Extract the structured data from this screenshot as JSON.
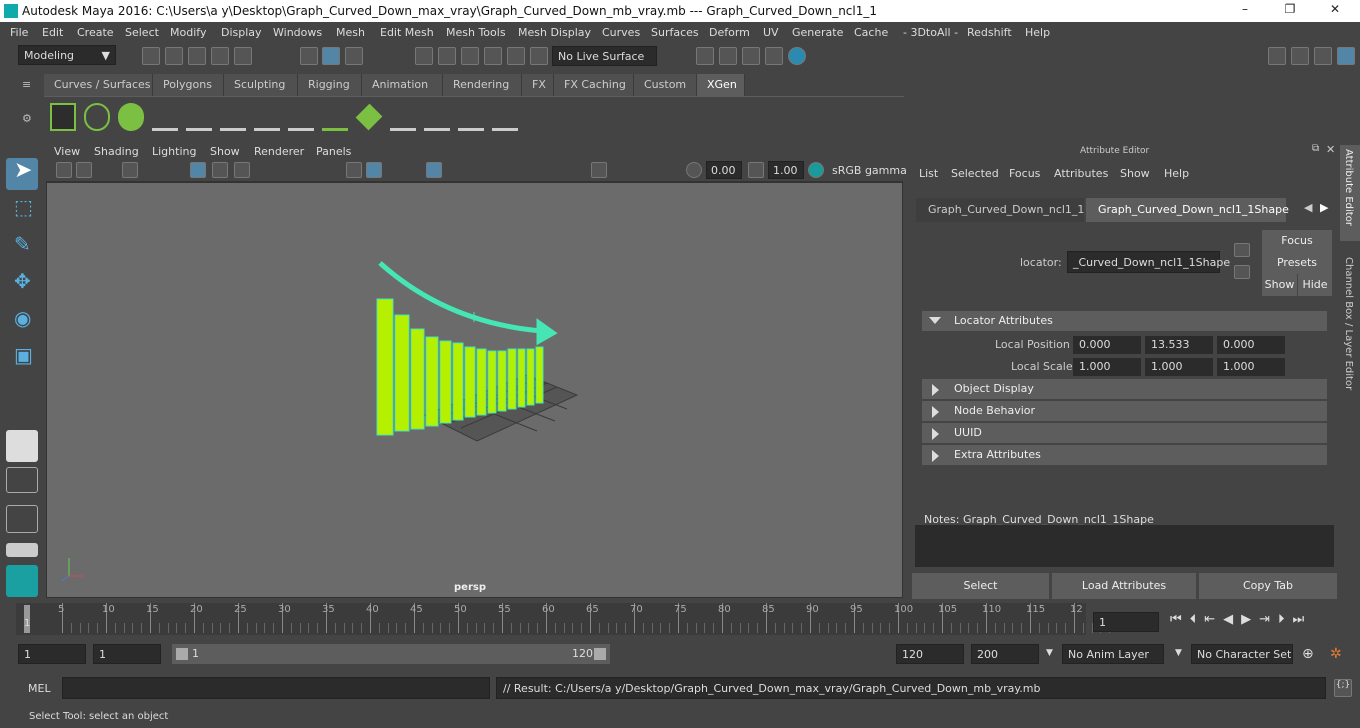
{
  "window": {
    "title": "Autodesk Maya 2016: C:\\Users\\a y\\Desktop\\Graph_Curved_Down_max_vray\\Graph_Curved_Down_mb_vray.mb   ---   Graph_Curved_Down_ncl1_1",
    "minimize": "–",
    "maximize": "❐",
    "close": "✕"
  },
  "menus": [
    "File",
    "Edit",
    "Create",
    "Select",
    "Modify",
    "Display",
    "Windows",
    "Mesh",
    "Edit Mesh",
    "Mesh Tools",
    "Mesh Display",
    "Curves",
    "Surfaces",
    "Deform",
    "UV",
    "Generate",
    "Cache",
    "- 3DtoAll -",
    "Redshift",
    "Help"
  ],
  "status": {
    "mode": "Modeling",
    "live_surface": "No Live Surface"
  },
  "shelf_tabs": [
    "Curves / Surfaces",
    "Polygons",
    "Sculpting",
    "Rigging",
    "Animation",
    "Rendering",
    "FX",
    "FX Caching",
    "Custom",
    "XGen"
  ],
  "shelf_active": "XGen",
  "viewport": {
    "menus": [
      "View",
      "Shading",
      "Lighting",
      "Show",
      "Renderer",
      "Panels"
    ],
    "exposure": "0.00",
    "gamma": "1.00",
    "colorspace": "sRGB gamma",
    "camera": "persp"
  },
  "ae": {
    "title": "Attribute Editor",
    "menus": [
      "List",
      "Selected",
      "Focus",
      "Attributes",
      "Show",
      "Help"
    ],
    "tabs": [
      "Graph_Curved_Down_ncl1_1",
      "Graph_Curved_Down_ncl1_1Shape"
    ],
    "locator_label": "locator:",
    "locator_value": "_Curved_Down_ncl1_1Shape",
    "focus": "Focus",
    "presets": "Presets",
    "show": "Show",
    "hide": "Hide",
    "sections": {
      "locator": "Locator Attributes",
      "object_display": "Object Display",
      "node_behavior": "Node Behavior",
      "uuid": "UUID",
      "extra": "Extra Attributes"
    },
    "local_position_label": "Local Position",
    "local_position": [
      "0.000",
      "13.533",
      "0.000"
    ],
    "local_scale_label": "Local Scale",
    "local_scale": [
      "1.000",
      "1.000",
      "1.000"
    ],
    "notes": "Notes:  Graph_Curved_Down_ncl1_1Shape",
    "select": "Select",
    "load": "Load Attributes",
    "copy": "Copy Tab"
  },
  "side_tabs": {
    "ae": "Attribute Editor",
    "cb": "Channel Box / Layer Editor"
  },
  "timeline": {
    "ticks": [
      "1",
      "5",
      "10",
      "15",
      "20",
      "25",
      "30",
      "35",
      "40",
      "45",
      "50",
      "55",
      "60",
      "65",
      "70",
      "75",
      "80",
      "85",
      "90",
      "95",
      "100",
      "105",
      "110",
      "115",
      "12"
    ],
    "current": "1"
  },
  "range": {
    "start": "1",
    "start2": "1",
    "slider_start": "1",
    "slider_end": "120",
    "end": "120",
    "end2": "200",
    "anim_layer": "No Anim Layer",
    "char_set": "No Character Set"
  },
  "cmd": {
    "label": "MEL",
    "result": "// Result: C:/Users/a y/Desktop/Graph_Curved_Down_max_vray/Graph_Curved_Down_mb_vray.mb"
  },
  "help": "Select Tool: select an object",
  "colors": {
    "accent": "#5285a6",
    "mesh": "#b4f000",
    "wire": "#46e6b4"
  }
}
